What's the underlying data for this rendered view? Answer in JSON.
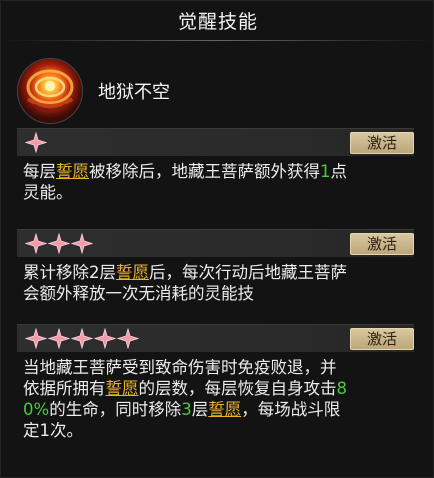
{
  "title": "觉醒技能",
  "skill": {
    "name": "地狱不空",
    "icon": "flame-vortex-icon"
  },
  "colors": {
    "keyword": "#e9b528",
    "number": "#49c93c",
    "star": "#f39aa8",
    "button": "#d2bf96"
  },
  "tiers": [
    {
      "stars": 1,
      "button_label": "激活",
      "desc": [
        {
          "t": "每层"
        },
        {
          "t": "誓愿",
          "k": "kw"
        },
        {
          "t": "被移除后，地藏王菩萨额外获得"
        },
        {
          "t": "1",
          "k": "num"
        },
        {
          "t": "点\n灵能。"
        }
      ]
    },
    {
      "stars": 3,
      "button_label": "激活",
      "desc": [
        {
          "t": "累计移除2层"
        },
        {
          "t": "誓愿",
          "k": "kw"
        },
        {
          "t": "后，每次行动后地藏王菩萨\n会额外释放一次无消耗的灵能技"
        }
      ]
    },
    {
      "stars": 5,
      "button_label": "激活",
      "desc": [
        {
          "t": "当地藏王菩萨受到致命伤害时免疫败退，并\n依据所拥有"
        },
        {
          "t": "誓愿",
          "k": "kw"
        },
        {
          "t": "的层数，每层恢复自身攻击"
        },
        {
          "t": "8\n0%",
          "k": "num"
        },
        {
          "t": "的生命，同时移除"
        },
        {
          "t": "3",
          "k": "num"
        },
        {
          "t": "层"
        },
        {
          "t": "誓愿",
          "k": "kw"
        },
        {
          "t": "，每场战斗限\n定1次。"
        }
      ]
    }
  ]
}
